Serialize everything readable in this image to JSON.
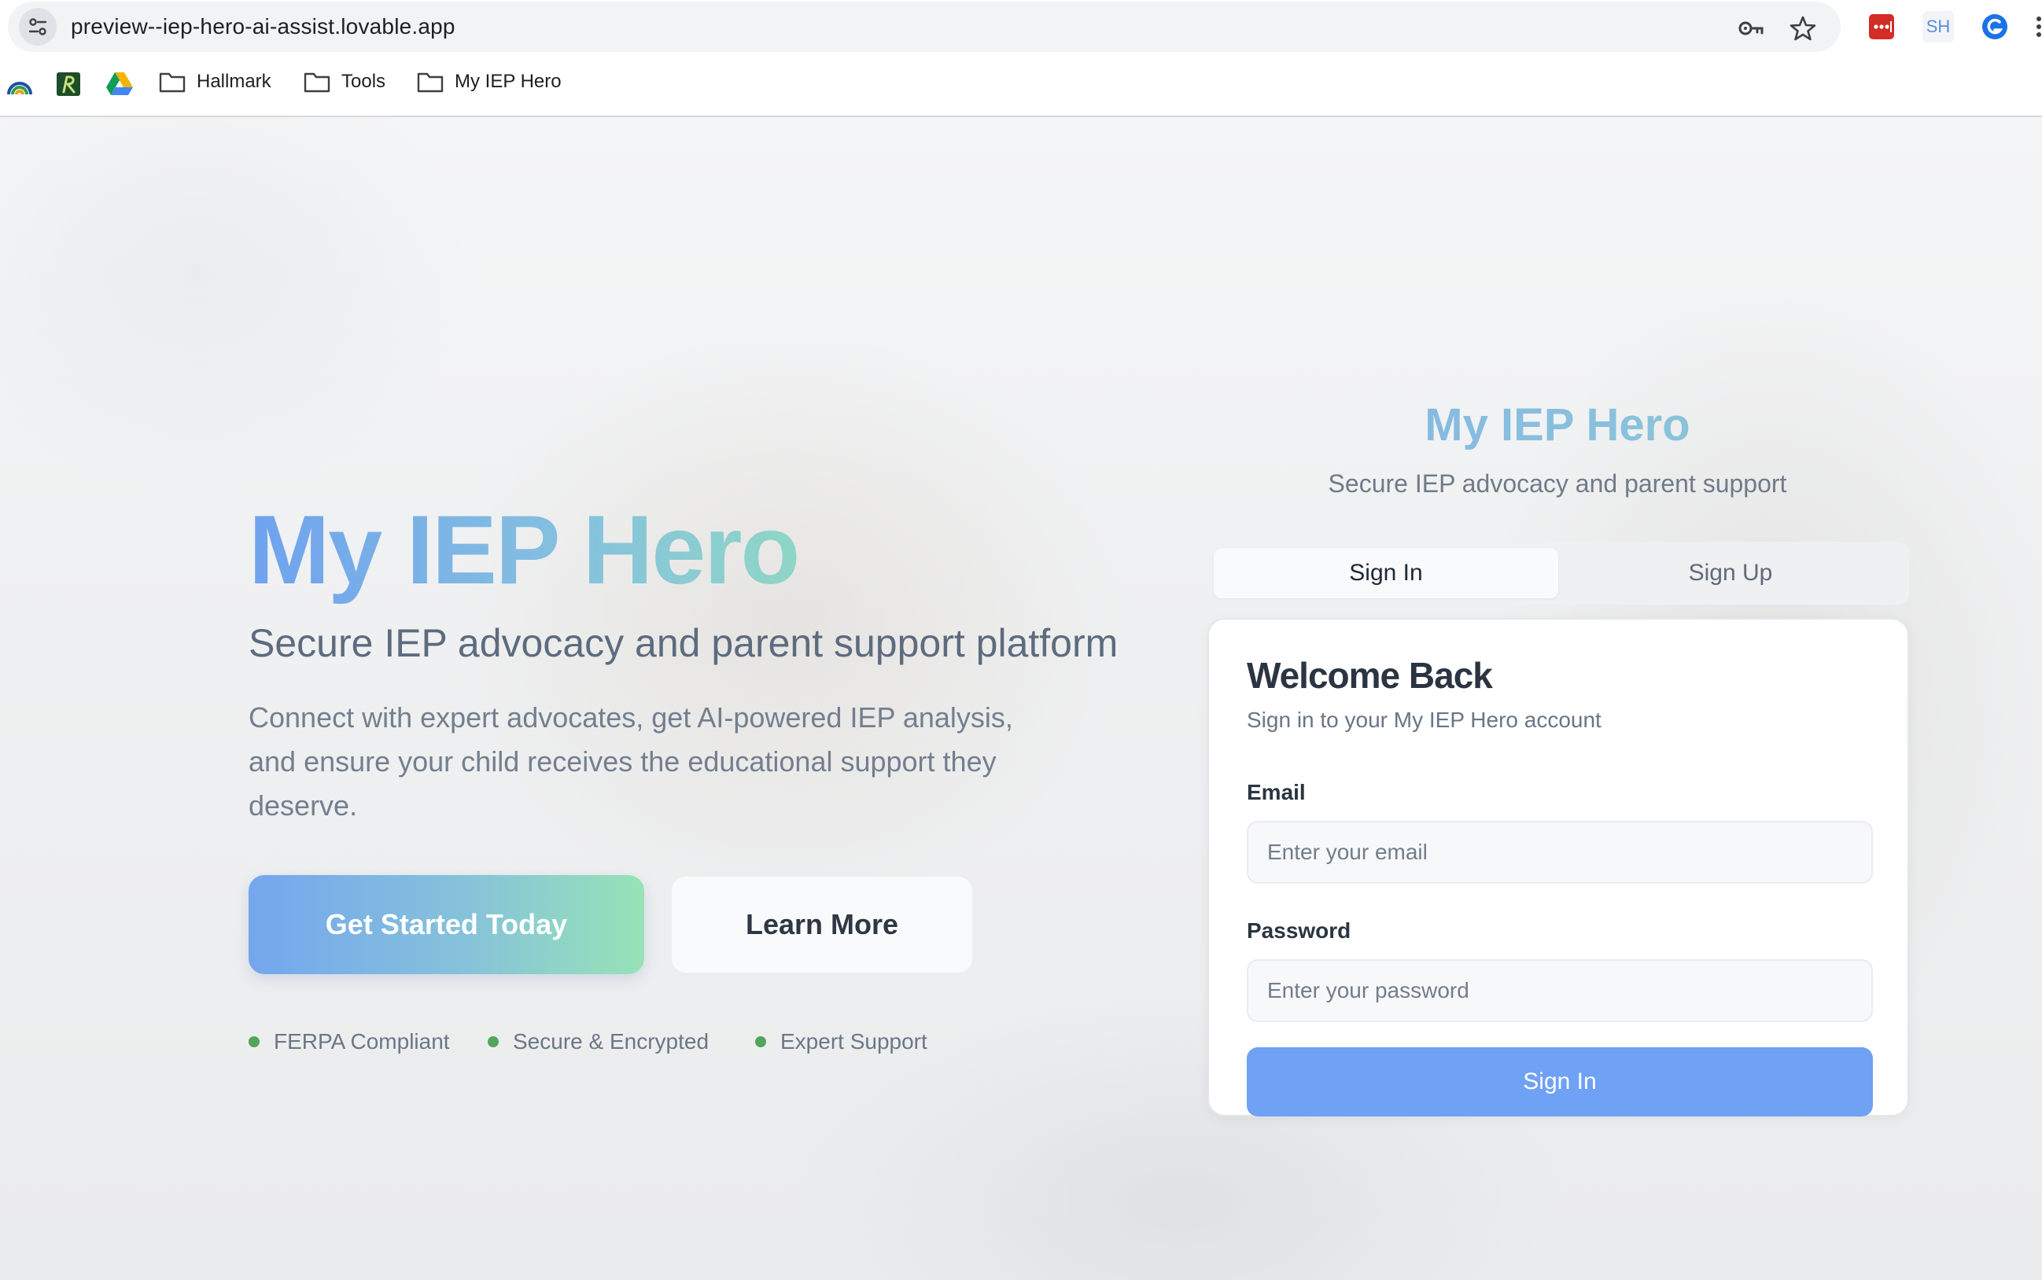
{
  "browser": {
    "url": "preview--iep-hero-ai-assist.lovable.app",
    "extension_label": "SH",
    "bookmarks": [
      {
        "label": "Hallmark"
      },
      {
        "label": "Tools"
      },
      {
        "label": "My IEP Hero"
      }
    ]
  },
  "hero": {
    "title": "My IEP Hero",
    "subtitle": "Secure IEP advocacy and parent support platform",
    "description": "Connect with expert advocates, get AI-powered IEP analysis, and ensure your child receives the educational support they deserve.",
    "primary_button": "Get Started Today",
    "secondary_button": "Learn More",
    "features": [
      "FERPA Compliant",
      "Secure & Encrypted",
      "Expert Support"
    ]
  },
  "auth": {
    "title": "My IEP Hero",
    "subtitle": "Secure IEP advocacy and parent support",
    "tabs": [
      "Sign In",
      "Sign Up"
    ],
    "active_tab": "Sign In",
    "card_title": "Welcome Back",
    "card_desc": "Sign in to your My IEP Hero account",
    "email_label": "Email",
    "email_placeholder": "Enter your email",
    "password_label": "Password",
    "password_placeholder": "Enter your password",
    "submit_label": "Sign In"
  },
  "colors": {
    "accent_blue": "#6fa1f5",
    "feature_dot": "#52a55a",
    "title_gradient_start": "#6fa2ee",
    "title_gradient_end": "#8fd6c6"
  },
  "icons": [
    "site-settings-icon",
    "password-key-icon",
    "bookmark-star-icon",
    "lastpass-extension-icon",
    "sh-extension-icon",
    "grammarly-extension-icon",
    "more-menu-icon",
    "rainbow-bookmark-icon",
    "rk-bookmark-icon",
    "google-drive-icon",
    "folder-icon"
  ]
}
